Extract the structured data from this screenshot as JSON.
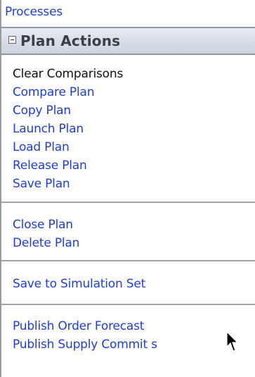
{
  "top_link": "Processes",
  "section": {
    "title": "Plan Actions",
    "collapse_icon": "minus-square-icon"
  },
  "groups": [
    {
      "items": [
        {
          "label": "Clear Comparisons",
          "link": false
        },
        {
          "label": "Compare Plan",
          "link": true
        },
        {
          "label": "Copy Plan",
          "link": true
        },
        {
          "label": "Launch Plan",
          "link": true
        },
        {
          "label": "Load Plan",
          "link": true
        },
        {
          "label": "Release Plan",
          "link": true
        },
        {
          "label": "Save Plan",
          "link": true
        }
      ]
    },
    {
      "items": [
        {
          "label": "Close Plan",
          "link": true
        },
        {
          "label": "Delete Plan",
          "link": true
        }
      ]
    },
    {
      "items": [
        {
          "label": "Save to Simulation Set",
          "link": true
        }
      ]
    },
    {
      "items": [
        {
          "label": "Publish Order Forecast",
          "link": true
        },
        {
          "label": "Publish Supply Commit s",
          "link": true
        }
      ]
    }
  ],
  "colors": {
    "link": "#1f3fc8",
    "static_text": "#111111",
    "header_bg": "#d7dde6"
  },
  "icons": [
    "minus-square-icon",
    "mouse-pointer-icon"
  ]
}
